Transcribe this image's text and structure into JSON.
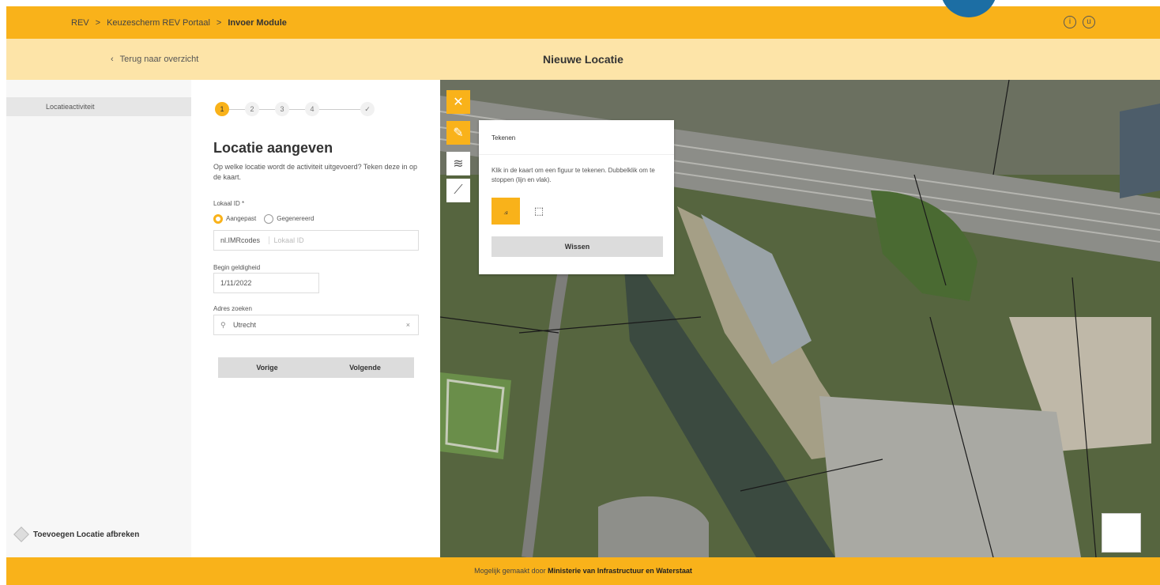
{
  "header": {
    "breadcrumbs": [
      "REV",
      "Keuzescherm REV Portaal",
      "Invoer Module"
    ],
    "separator": ">"
  },
  "subheader": {
    "back_label": "Terug naar overzicht",
    "back_icon": "chevron-left-icon",
    "title": "Nieuwe Locatie"
  },
  "sidebar": {
    "items": [
      {
        "label": "Locatieactiviteit"
      }
    ],
    "bottom_label": "Toevoegen Locatie afbreken"
  },
  "form": {
    "steps": [
      "1",
      "2",
      "3",
      "4",
      "✓"
    ],
    "title": "Locatie aangeven",
    "description": "Op welke locatie wordt de activiteit uitgevoerd? Teken deze in op de kaart.",
    "lokaal_id_label": "Lokaal ID *",
    "radio_options": [
      "Aangepast",
      "Gegenereerd"
    ],
    "prefix_label": "nl.IMRcodes",
    "lokaal_id_placeholder": "Lokaal ID",
    "begin_label": "Begin geldigheid",
    "begin_value": "1/11/2022",
    "adres_label": "Adres zoeken",
    "adres_value": "Utrecht",
    "prev_button": "Vorige",
    "next_button": "Volgende"
  },
  "draw_panel": {
    "title": "Tekenen",
    "instruction": "Klik in de kaart om een figuur te tekenen. Dubbelklik om te stoppen (lijn en vlak).",
    "clear_button": "Wissen"
  },
  "footer": {
    "prefix": "Mogelijk gemaakt door",
    "org": "Ministerie van Infrastructuur en Waterstaat"
  },
  "colors": {
    "accent": "#f9b21a",
    "subbar": "#fde4a8"
  }
}
